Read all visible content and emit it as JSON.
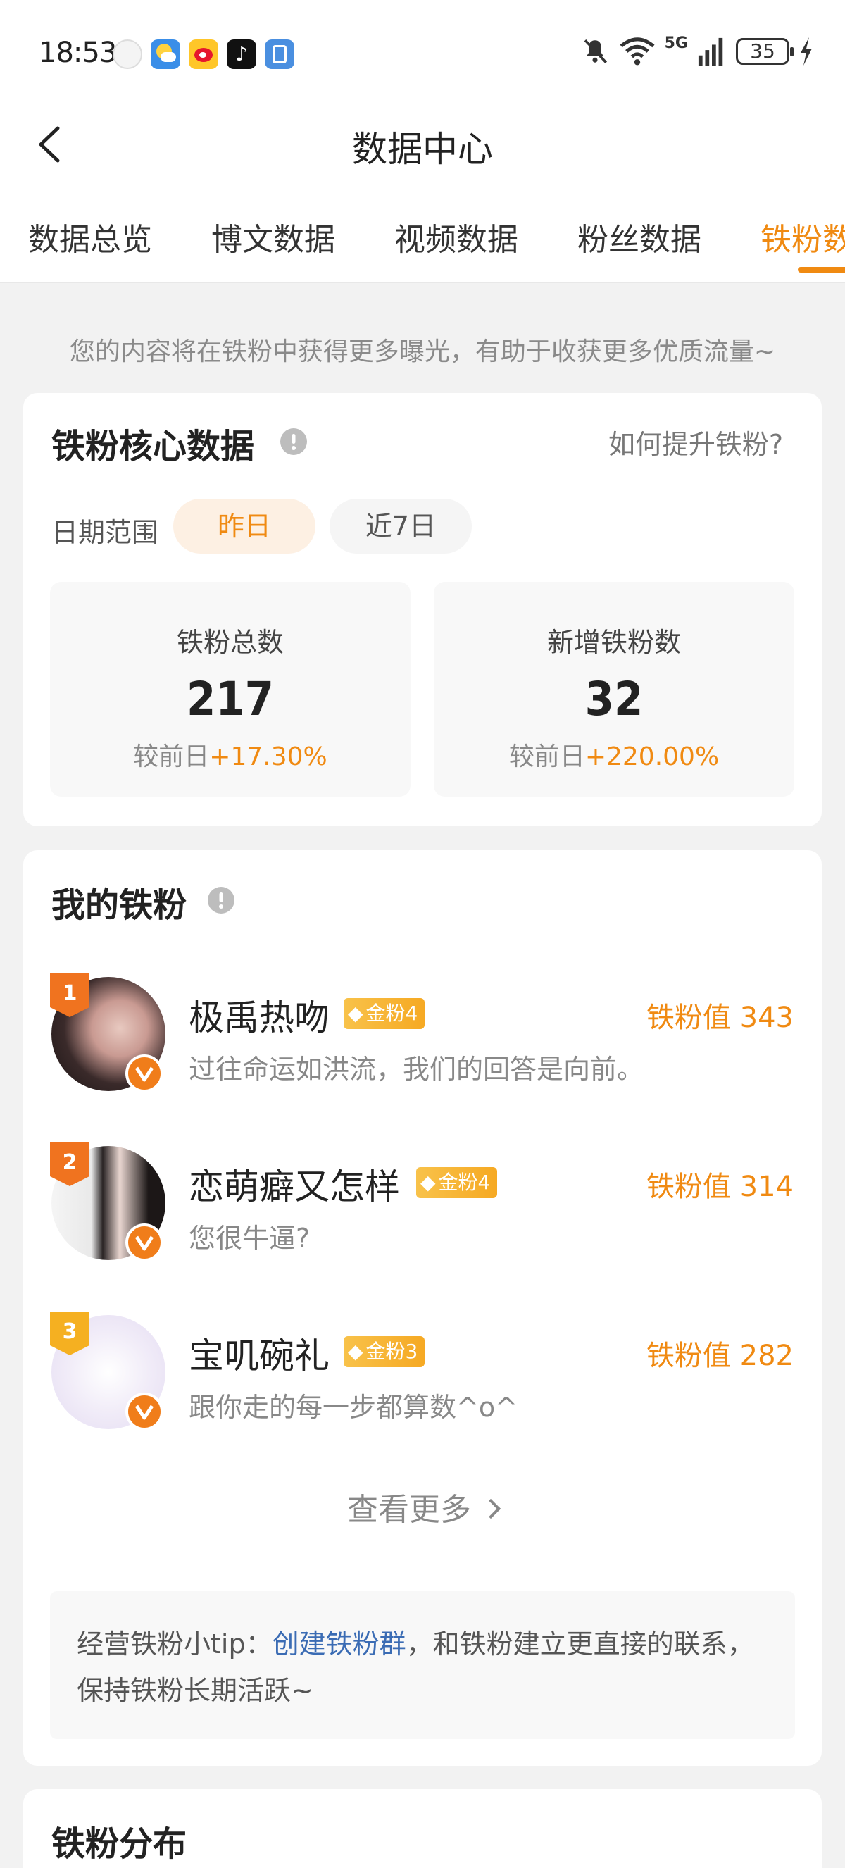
{
  "status_bar": {
    "time": "18:53",
    "battery": "35",
    "network": "5G",
    "app_icons": [
      "assistant-icon",
      "weather-icon",
      "weibo-icon",
      "tiktok-icon",
      "gallery-icon"
    ]
  },
  "header": {
    "title": "数据中心"
  },
  "tabs": [
    {
      "label": "数据总览",
      "active": false
    },
    {
      "label": "博文数据",
      "active": false
    },
    {
      "label": "视频数据",
      "active": false
    },
    {
      "label": "粉丝数据",
      "active": false
    },
    {
      "label": "铁粉数据",
      "active": true
    }
  ],
  "notice": "您的内容将在铁粉中获得更多曝光，有助于收获更多优质流量~",
  "core": {
    "title": "铁粉核心数据",
    "how_link": "如何提升铁粉?",
    "date_label": "日期范围",
    "chip_yesterday": "昨日",
    "chip_week": "近7日",
    "total": {
      "label": "铁粉总数",
      "value": "217",
      "compare_prefix": "较前日",
      "delta": "+17.30%"
    },
    "new": {
      "label": "新增铁粉数",
      "value": "32",
      "compare_prefix": "较前日",
      "delta": "+220.00%"
    }
  },
  "my_fans": {
    "title": "我的铁粉",
    "list": [
      {
        "rank": "1",
        "name": "极禹热吻",
        "badge": "金粉4",
        "value": "铁粉值 343",
        "signature": "过往命运如洪流，我们的回答是向前。"
      },
      {
        "rank": "2",
        "name": "恋萌癖又怎样",
        "badge": "金粉4",
        "value": "铁粉值 314",
        "signature": "您很牛逼?"
      },
      {
        "rank": "3",
        "name": "宝叽碗礼",
        "badge": "金粉3",
        "value": "铁粉值 282",
        "signature": "跟你走的每一步都算数^o^"
      }
    ],
    "view_more": "查看更多",
    "tip_prefix": "经营铁粉小tip：",
    "tip_link": "创建铁粉群",
    "tip_suffix": "，和铁粉建立更直接的联系，保持铁粉长期活跃~"
  },
  "distribution": {
    "title": "铁粉分布"
  },
  "colors": {
    "accent": "#f08a12",
    "link": "#3b6cb4",
    "gold_badge": "#f6a923"
  }
}
